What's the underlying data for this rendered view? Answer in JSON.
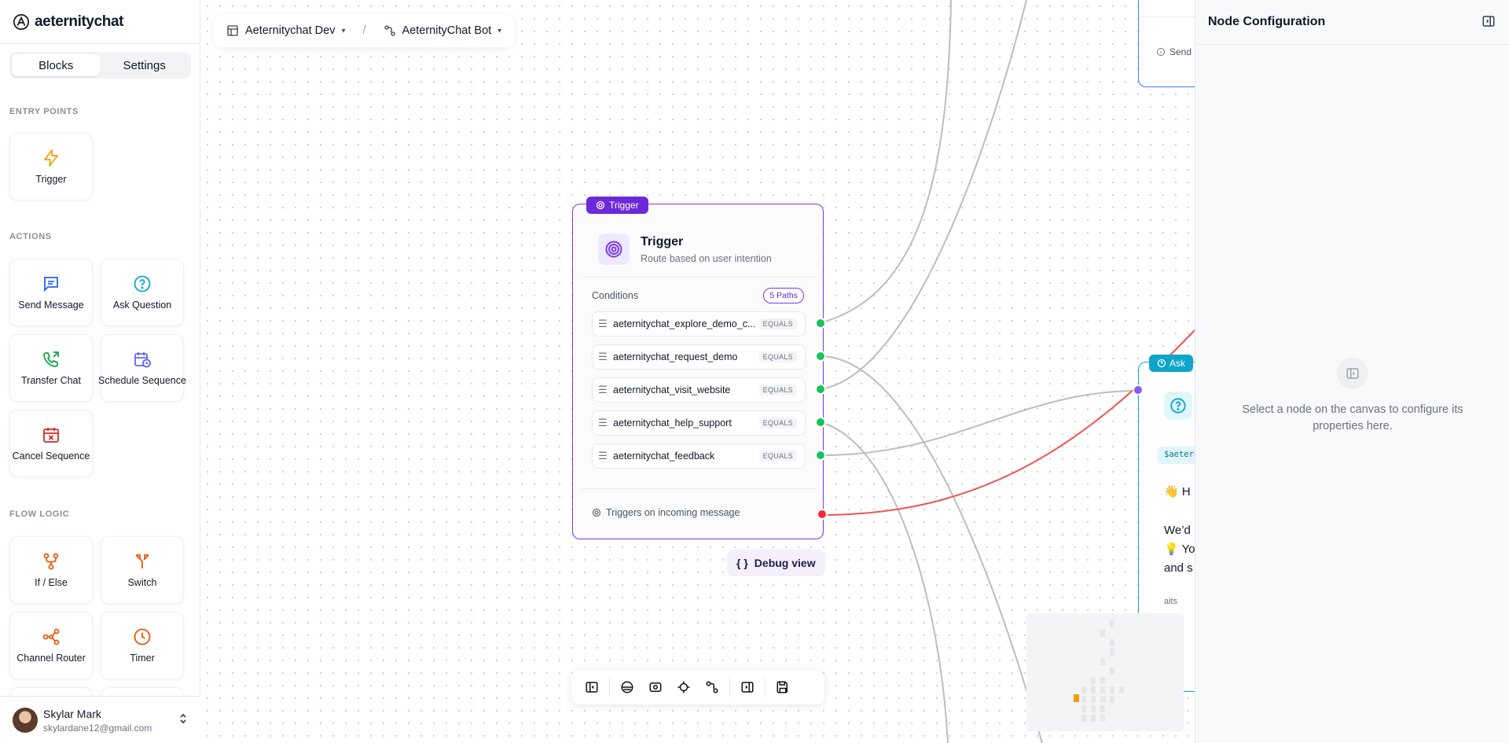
{
  "brand": {
    "name": "aeternitychat"
  },
  "sidebar": {
    "tabs": [
      {
        "label": "Blocks"
      },
      {
        "label": "Settings"
      }
    ],
    "sections": {
      "entry_points": "ENTRY POINTS",
      "actions": "ACTIONS",
      "flow_logic": "FLOW LOGIC"
    },
    "blocks": {
      "trigger": "Trigger",
      "send_message": "Send Message",
      "ask_question": "Ask Question",
      "transfer_chat": "Transfer Chat",
      "schedule_sequence": "Schedule Sequence",
      "cancel_sequence": "Cancel Sequence",
      "if_else": "If / Else",
      "switch": "Switch",
      "channel_router": "Channel Router",
      "timer": "Timer"
    },
    "user": {
      "name": "Skylar Mark",
      "email": "skylardane12@gmail.com"
    }
  },
  "breadcrumb": {
    "workspace": "Aeternitychat Dev",
    "separator": "/",
    "bot": "AeternityChat Bot"
  },
  "trigger_node": {
    "tag": "Trigger",
    "title": "Trigger",
    "subtitle": "Route based on user intention",
    "conditions_label": "Conditions",
    "paths_badge": "5 Paths",
    "conditions": [
      {
        "name": "aeternitychat_explore_demo_c...",
        "op": "EQUALS"
      },
      {
        "name": "aeternitychat_request_demo",
        "op": "EQUALS"
      },
      {
        "name": "aeternitychat_visit_website",
        "op": "EQUALS"
      },
      {
        "name": "aeternitychat_help_support",
        "op": "EQUALS"
      },
      {
        "name": "aeternitychat_feedback",
        "op": "EQUALS"
      }
    ],
    "footer": "Triggers on incoming message"
  },
  "debug_view": {
    "label": "Debug view"
  },
  "send_node_partial": {
    "text": "Send"
  },
  "ask_node_partial": {
    "tag": "Ask",
    "variable": "$aetern",
    "line1": "👋 H",
    "line2": "We’d",
    "line3": "💡 Yo",
    "line4": "and s",
    "line5": "aits"
  },
  "panel": {
    "title": "Node Configuration",
    "empty_text": "Select a node on the canvas to configure its properties here."
  },
  "colors": {
    "trigger_accent": "#7c3aed",
    "ask_accent": "#0ea5c9",
    "send_accent": "#3b82f6",
    "handle_green": "#16c45a",
    "handle_red": "#ef2b3c",
    "edge_gray": "#bdbdbd",
    "edge_red": "#ef5350"
  },
  "icons": {
    "toolbar": [
      "sidebar-left-icon",
      "layers-icon",
      "focus-icon",
      "crosshair-icon",
      "flow-icon",
      "sidebar-right-icon",
      "save-icon"
    ]
  }
}
